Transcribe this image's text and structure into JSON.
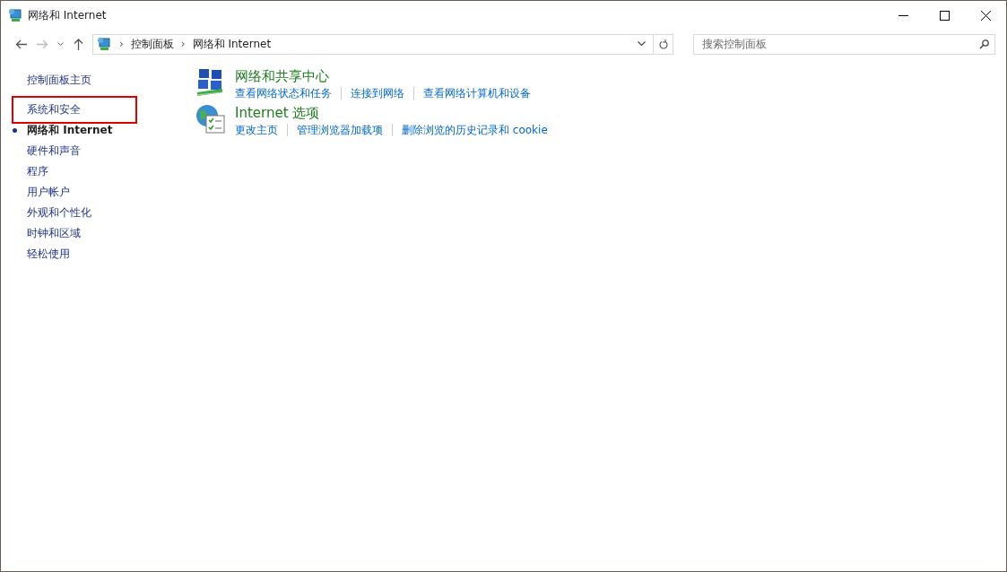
{
  "window": {
    "title": "网络和 Internet"
  },
  "address_bar": {
    "breadcrumbs": [
      "控制面板",
      "网络和 Internet"
    ],
    "separator": "›"
  },
  "search": {
    "placeholder": "搜索控制面板"
  },
  "sidebar": {
    "home": "控制面板主页",
    "items": [
      {
        "label": "系统和安全",
        "selected": false,
        "highlighted": true
      },
      {
        "label": "网络和 Internet",
        "selected": true,
        "highlighted": false
      },
      {
        "label": "硬件和声音",
        "selected": false,
        "highlighted": false
      },
      {
        "label": "程序",
        "selected": false,
        "highlighted": false
      },
      {
        "label": "用户帐户",
        "selected": false,
        "highlighted": false
      },
      {
        "label": "外观和个性化",
        "selected": false,
        "highlighted": false
      },
      {
        "label": "时钟和区域",
        "selected": false,
        "highlighted": false
      },
      {
        "label": "轻松使用",
        "selected": false,
        "highlighted": false
      }
    ]
  },
  "categories": [
    {
      "kind": "network",
      "title": "网络和共享中心",
      "links": [
        "查看网络状态和任务",
        "连接到网络",
        "查看网络计算机和设备"
      ]
    },
    {
      "kind": "internet",
      "title": "Internet 选项",
      "links": [
        "更改主页",
        "管理浏览器加载项",
        "删除浏览的历史记录和 cookie"
      ]
    }
  ]
}
